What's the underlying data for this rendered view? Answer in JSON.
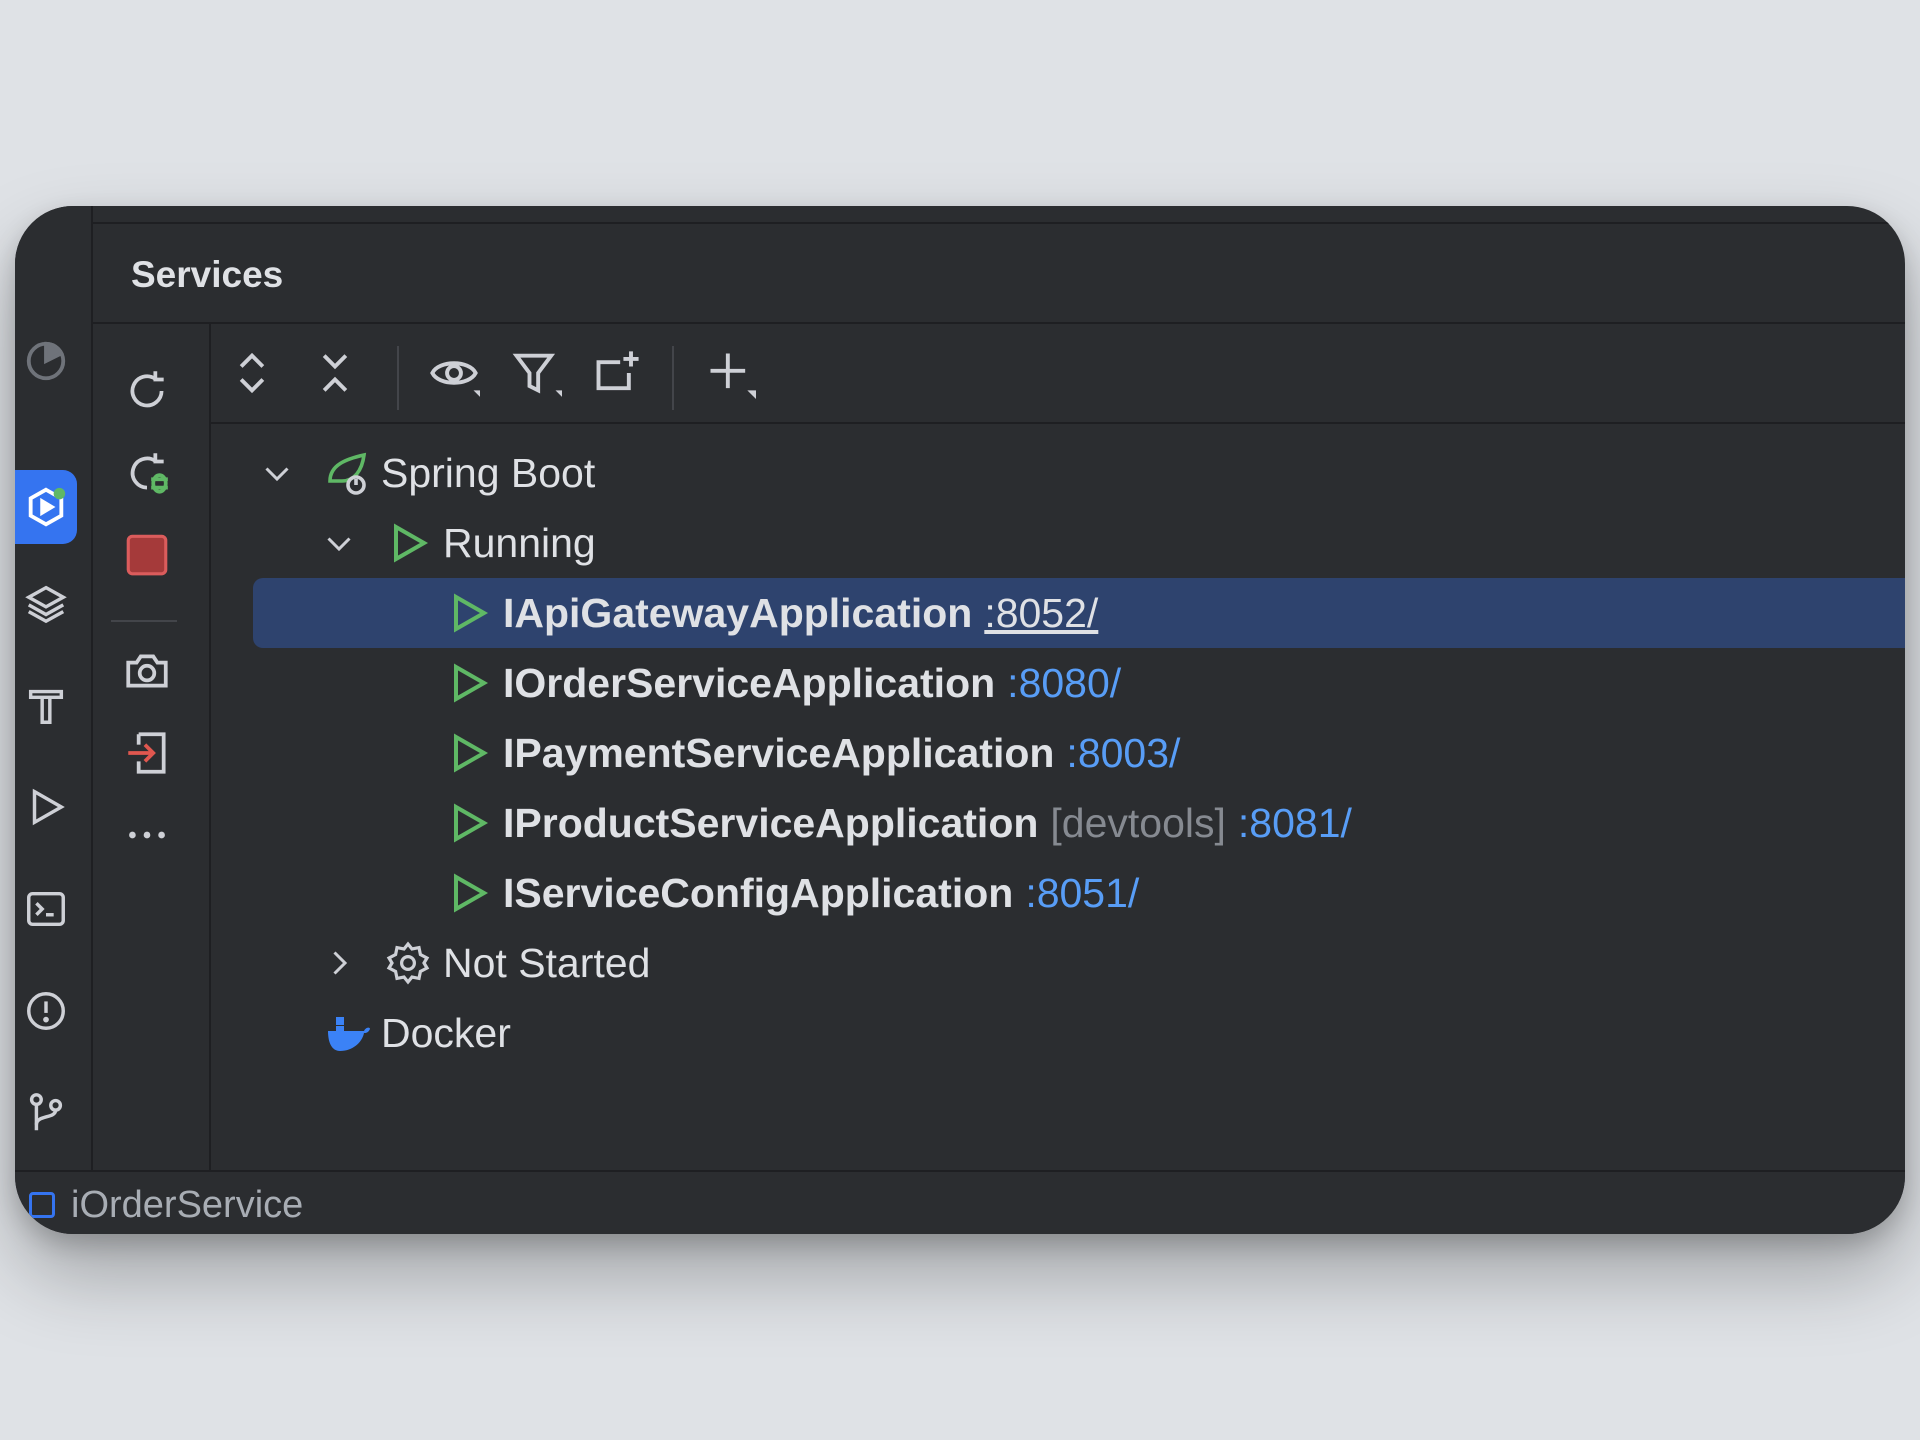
{
  "panel": {
    "title": "Services"
  },
  "left_bar": {
    "icons": [
      "profiler-icon",
      "services-icon",
      "layers-icon",
      "build-icon",
      "run-icon",
      "terminal-icon",
      "problems-icon",
      "git-icon"
    ],
    "active": "services-icon"
  },
  "actions": [
    "rerun-icon",
    "rerun-debug-icon",
    "stop-icon",
    "snapshot-icon",
    "exit-icon",
    "more-icon"
  ],
  "toolbar": [
    "expand-all-icon",
    "collapse-all-icon",
    "view-options-icon",
    "filter-icon",
    "new-group-icon",
    "add-service-icon"
  ],
  "tree": {
    "spring_boot": {
      "label": "Spring Boot",
      "expanded": true
    },
    "running": {
      "label": "Running",
      "expanded": true
    },
    "apps": [
      {
        "name": "IApiGatewayApplication",
        "tag": "",
        "port": ":8052/",
        "selected": true
      },
      {
        "name": "IOrderServiceApplication",
        "tag": "",
        "port": ":8080/",
        "selected": false
      },
      {
        "name": "IPaymentServiceApplication",
        "tag": "",
        "port": ":8003/",
        "selected": false
      },
      {
        "name": "IProductServiceApplication",
        "tag": "[devtools]",
        "port": ":8081/",
        "selected": false
      },
      {
        "name": "IServiceConfigApplication",
        "tag": "",
        "port": ":8051/",
        "selected": false
      }
    ],
    "not_started": {
      "label": "Not Started",
      "expanded": false
    },
    "docker": {
      "label": "Docker"
    }
  },
  "status_bar": {
    "text": "iOrderService"
  },
  "colors": {
    "accent": "#3574f0",
    "run_green": "#5fb865",
    "port_blue": "#589df6",
    "stop_red": "#c94f4f",
    "selection": "#2e436e"
  }
}
